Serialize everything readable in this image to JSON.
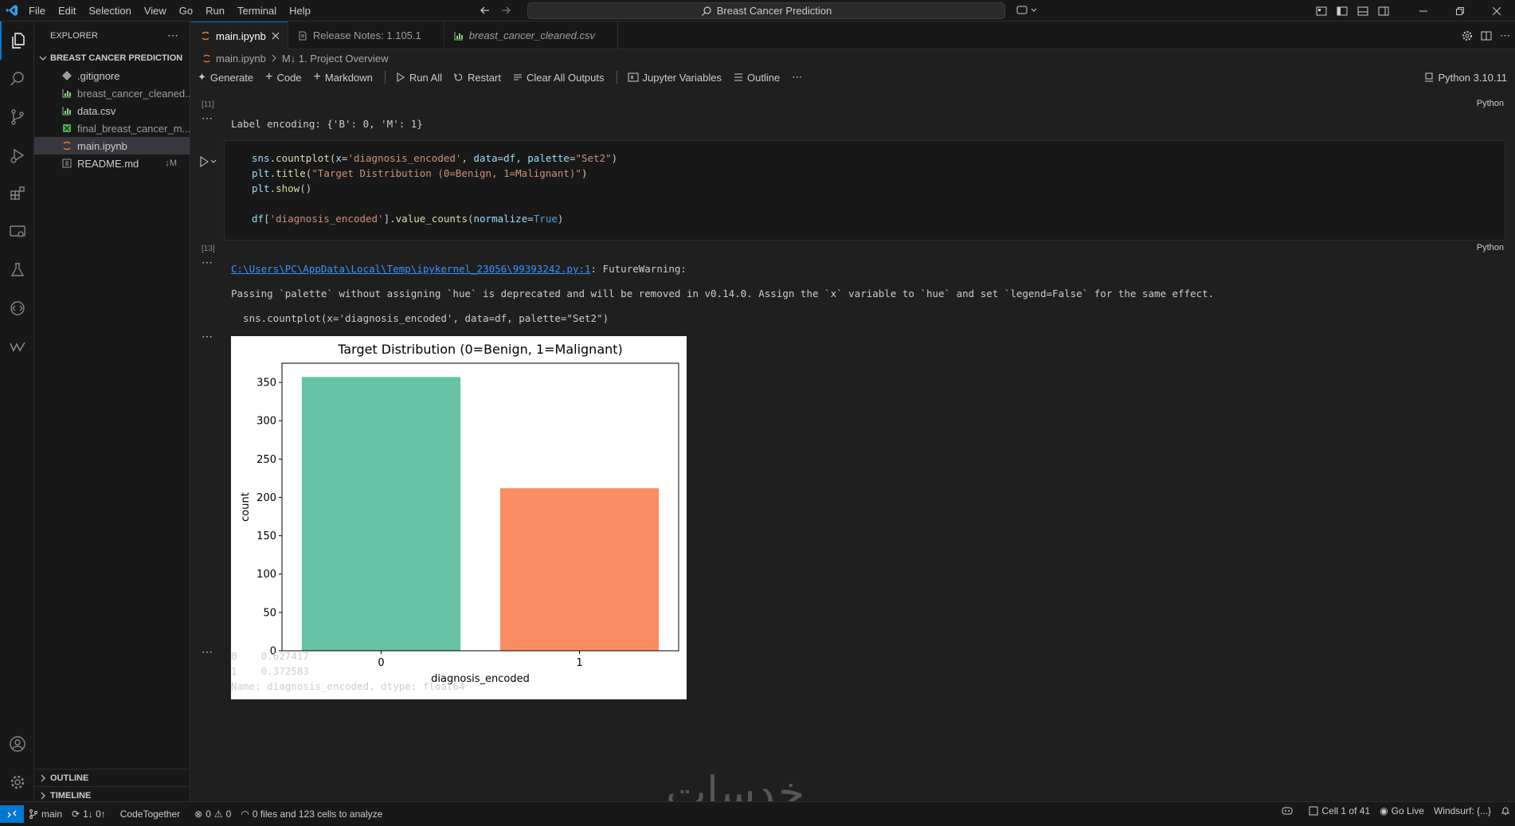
{
  "menu": [
    "File",
    "Edit",
    "Selection",
    "View",
    "Go",
    "Run",
    "Terminal",
    "Help"
  ],
  "search": {
    "text": "Breast Cancer Prediction"
  },
  "explorer": {
    "title": "EXPLORER",
    "folder": "BREAST CANCER PREDICTION",
    "files": [
      {
        "name": ".gitignore",
        "status": ""
      },
      {
        "name": "breast_cancer_cleaned...",
        "status": ""
      },
      {
        "name": "data.csv",
        "status": ""
      },
      {
        "name": "final_breast_cancer_m...",
        "status": ""
      },
      {
        "name": "main.ipynb",
        "status": ""
      },
      {
        "name": "README.md",
        "status": "↓M"
      }
    ],
    "outline": "OUTLINE",
    "timeline": "TIMELINE"
  },
  "tabs": [
    {
      "label": "main.ipynb"
    },
    {
      "label": "Release Notes: 1.105.1"
    },
    {
      "label": "breast_cancer_cleaned.csv"
    }
  ],
  "breadcrumb": {
    "file": "main.ipynb",
    "section": "M↓ 1. Project Overview"
  },
  "toolbar": {
    "generate": "Generate",
    "code": "Code",
    "markdown": "Markdown",
    "run_all": "Run All",
    "restart": "Restart",
    "clear": "Clear All Outputs",
    "variables": "Jupyter Variables",
    "outline": "Outline",
    "kernel": "Python 3.10.11"
  },
  "cells": {
    "c11": {
      "exec": "[11]",
      "lang": "Python",
      "output": "Label encoding: {'B': 0, 'M': 1}"
    },
    "c13": {
      "exec": "[13]",
      "lang": "Python",
      "l1": {
        "a": "sns",
        "b": ".",
        "c": "countplot",
        "d": "(",
        "e": "x",
        "f": "=",
        "g": "'diagnosis_encoded'",
        "h": ", ",
        "i": "data",
        "j": "=",
        "k": "df",
        "l": ", ",
        "m": "palette",
        "n": "=",
        "o": "\"Set2\"",
        "p": ")"
      },
      "l2": {
        "a": "plt",
        "b": ".",
        "c": "title",
        "d": "(",
        "e": "\"Target Distribution (0=Benign, 1=Malignant)\"",
        "f": ")"
      },
      "l3": {
        "a": "plt",
        "b": ".",
        "c": "show",
        "d": "()"
      },
      "l4": {
        "a": "df",
        "b": "[",
        "c": "'diagnosis_encoded'",
        "d": "].",
        "e": "value_counts",
        "f": "(",
        "g": "normalize",
        "h": "=",
        "i": "True",
        "j": ")"
      },
      "warn_path": "C:\\Users\\PC\\AppData\\Local\\Temp\\ipykernel_23056\\99393242.py:1",
      "warn_tail": ": FutureWarning:",
      "warn_msg": "Passing `palette` without assigning `hue` is deprecated and will be removed in v0.14.0. Assign the `x` variable to `hue` and set `legend=False` for the same effect.",
      "warn_code": "  sns.countplot(x='diagnosis_encoded', data=df, palette=\"Set2\")",
      "result1": "0    0.627417",
      "result2": "1    0.372583",
      "result3": "Name: diagnosis_encoded, dtype: float64"
    }
  },
  "chart_data": {
    "type": "bar",
    "title": "Target Distribution (0=Benign, 1=Malignant)",
    "categories": [
      "0",
      "1"
    ],
    "values": [
      357,
      212
    ],
    "colors": [
      "#66c2a5",
      "#fc8d62"
    ],
    "xlabel": "diagnosis_encoded",
    "ylabel": "count",
    "ylim": [
      0,
      375
    ],
    "yticks": [
      0,
      50,
      100,
      150,
      200,
      250,
      300,
      350
    ]
  },
  "statusbar": {
    "branch": "main",
    "sync": "1↓ 0↑",
    "codetogether": "CodeTogether",
    "problems_err": "0",
    "problems_warn": "0",
    "analyze": "0 files and 123 cells to analyze",
    "cell": "Cell 1 of 41",
    "golive": "Go Live",
    "windsurf": "Windsurf: {...}"
  },
  "watermark": "خدسات",
  "colors": {
    "accent": "#0078d4",
    "link": "#3794ff",
    "string": "#ce9178",
    "function": "#dcdcaa",
    "variable": "#9cdcfe",
    "keyword": "#569cd6"
  }
}
